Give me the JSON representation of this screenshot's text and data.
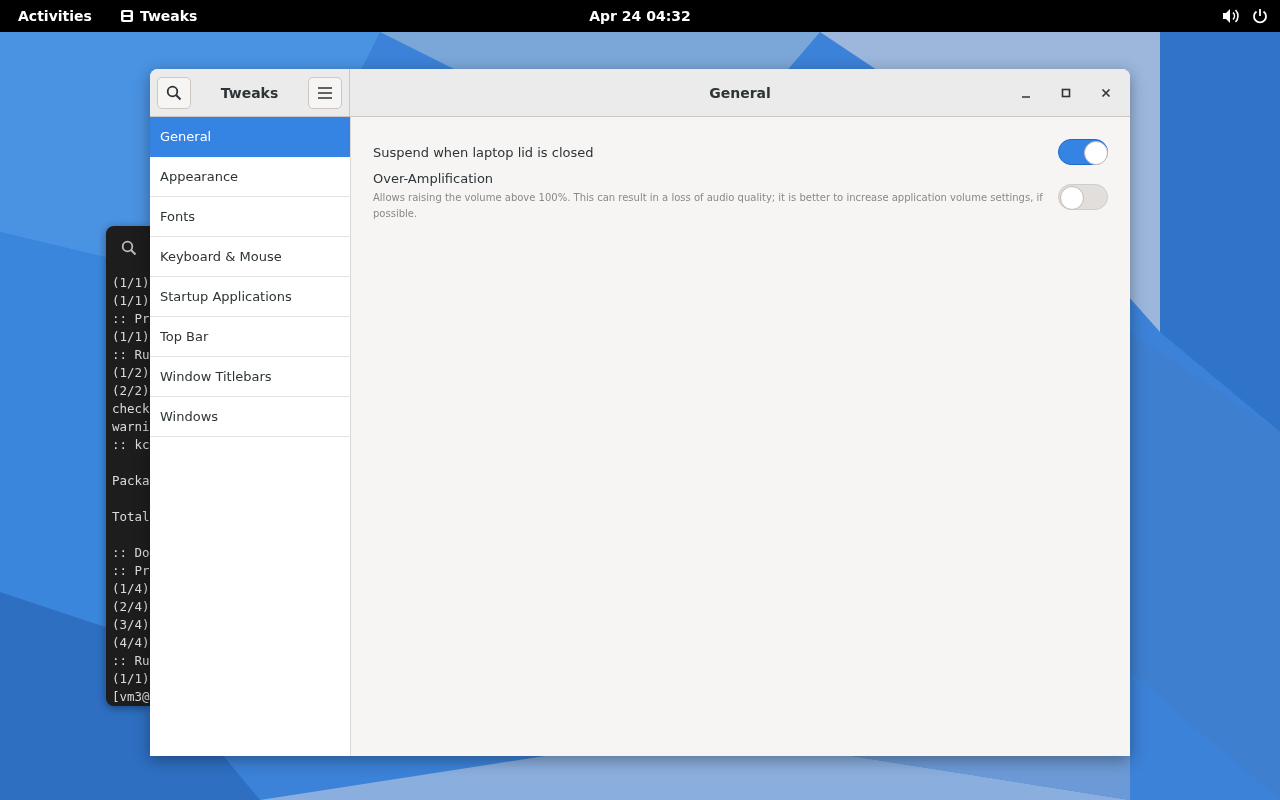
{
  "top_bar": {
    "activities": "Activities",
    "app_menu": "Tweaks",
    "clock": "Apr 24  04:32"
  },
  "terminal": {
    "blocks": [
      [
        "(1/1)",
        "(1/1)",
        ":: Pr",
        "(1/1)",
        ":: Ru",
        "(1/2)",
        "(2/2)",
        "check",
        "warni",
        ":: kc"
      ],
      [
        "Packa"
      ],
      [
        "Total"
      ],
      [
        ":: Do",
        ":: Pr",
        "(1/4)",
        "(2/4)",
        "(3/4)",
        "(4/4)",
        ":: Ru",
        "(1/1)",
        "[vm3@"
      ]
    ]
  },
  "window": {
    "app_title": "Tweaks",
    "page_title": "General"
  },
  "sidebar": {
    "items": [
      {
        "label": "General",
        "selected": true
      },
      {
        "label": "Appearance",
        "selected": false
      },
      {
        "label": "Fonts",
        "selected": false
      },
      {
        "label": "Keyboard & Mouse",
        "selected": false
      },
      {
        "label": "Startup Applications",
        "selected": false
      },
      {
        "label": "Top Bar",
        "selected": false
      },
      {
        "label": "Window Titlebars",
        "selected": false
      },
      {
        "label": "Windows",
        "selected": false
      }
    ]
  },
  "settings": [
    {
      "label": "Suspend when laptop lid is closed",
      "on": true
    },
    {
      "label": "Over-Amplification",
      "description": "Allows raising the volume above 100%. This can result in a loss of audio quality; it is better to increase application volume settings, if possible.",
      "on": false
    }
  ]
}
